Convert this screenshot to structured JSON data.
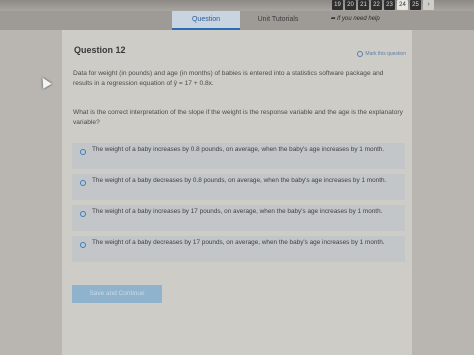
{
  "pager": {
    "pages": [
      "19",
      "20",
      "21",
      "22",
      "23",
      "24",
      "25"
    ],
    "current": "24",
    "next_icon": "chevron-right-icon"
  },
  "tabs": {
    "question": "Question",
    "tutorials": "Unit Tutorials",
    "back": "If you need help",
    "back_icon": "arrow-back-icon"
  },
  "question": {
    "title": "Question 12",
    "mark_label": "Mark this question",
    "prompt": "Data for weight (in pounds) and age (in months) of babies is entered into a statistics software package and results in a regression equation of ŷ = 17 + 0.8x.",
    "ask": "What is the correct interpretation of the slope if the weight is the response variable and the age is the explanatory variable?"
  },
  "options": [
    "The weight of a baby increases by 0.8 pounds, on average, when the baby's age increases by 1 month.",
    "The weight of a baby decreases by 0.8 pounds, on average, when the baby's age increases by 1 month.",
    "The weight of a baby increases by 17 pounds, on average, when the baby's age increases by 1 month.",
    "The weight of a baby decreases by 17 pounds, on average, when the baby's age increases by 1 month."
  ],
  "button": {
    "label": "Save and Continue"
  },
  "colors": {
    "accent": "#2b6cb8",
    "panel": "#ceccc7",
    "option_bg": "#c3c6c8",
    "button_bg": "#8fb3cc"
  }
}
